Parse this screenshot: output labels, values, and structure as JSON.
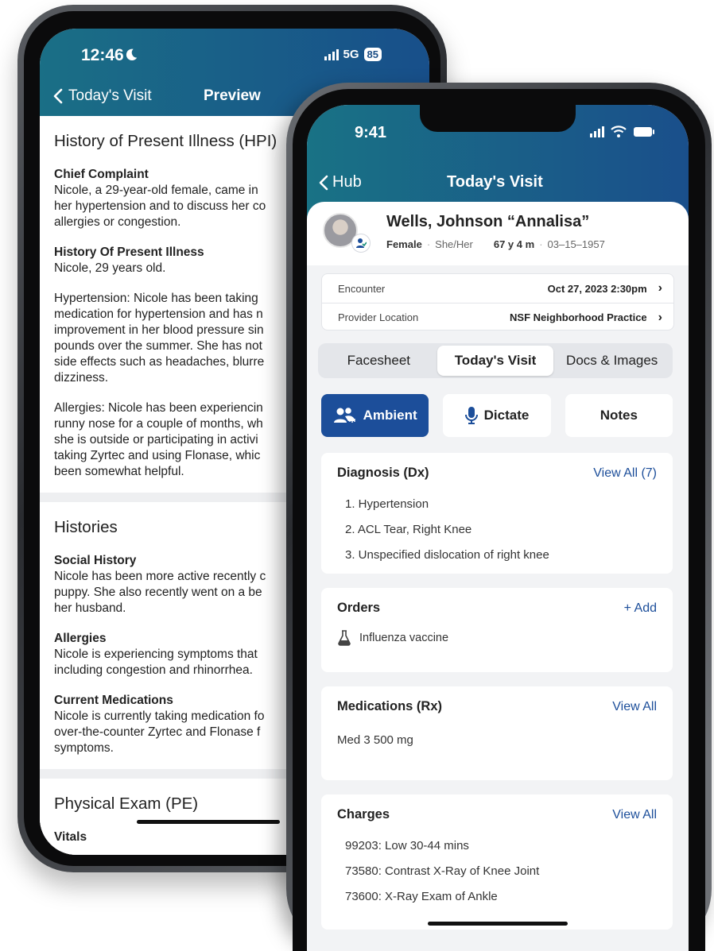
{
  "back_phone": {
    "status": {
      "time": "12:46",
      "network": "5G",
      "battery": "85"
    },
    "nav": {
      "back_label": "Today's Visit",
      "title": "Preview"
    },
    "sections": [
      {
        "title": "History of Present Illness (HPI)",
        "items": [
          {
            "heading": "Chief Complaint",
            "body": "Nicole, a 29-year-old female, came in\nher hypertension and to discuss her co\nallergies or congestion."
          },
          {
            "heading": "History Of Present Illness",
            "body": "Nicole, 29 years old."
          },
          {
            "heading": "",
            "body": "Hypertension: Nicole has been taking\nmedication for hypertension and has n\nimprovement in her blood pressure sin\npounds over the summer. She has not\nside effects such as headaches, blurre\ndizziness."
          },
          {
            "heading": "",
            "body": "Allergies: Nicole has been experiencin\nrunny nose for a couple of months, wh\nshe is outside or participating in activi\ntaking Zyrtec and using Flonase, whic\nbeen somewhat helpful."
          }
        ]
      },
      {
        "title": "Histories",
        "items": [
          {
            "heading": "Social History",
            "body": "Nicole has been more active recently c\npuppy. She also recently went on a be\nher husband."
          },
          {
            "heading": "Allergies",
            "body": "Nicole is experiencing symptoms that\nincluding congestion and rhinorrhea."
          },
          {
            "heading": "Current Medications",
            "body": "Nicole is currently taking medication fo\nover-the-counter Zyrtec and Flonase f\nsymptoms."
          }
        ]
      },
      {
        "title": "Physical Exam (PE)",
        "items": [
          {
            "heading": "Vitals",
            "body": ""
          }
        ]
      }
    ]
  },
  "front_phone": {
    "status": {
      "time": "9:41"
    },
    "nav": {
      "back_label": "Hub",
      "title": "Today's Visit"
    },
    "patient": {
      "name": "Wells, Johnson “Annalisa”",
      "sex": "Female",
      "pronouns": "She/Her",
      "age": "67 y 4 m",
      "dob": "03–15–1957"
    },
    "info_rows": [
      {
        "label": "Encounter",
        "value": "Oct 27, 2023 2:30pm"
      },
      {
        "label": "Provider Location",
        "value": "NSF Neighborhood Practice"
      }
    ],
    "tabs": [
      {
        "label": "Facesheet",
        "active": false
      },
      {
        "label": "Today's Visit",
        "active": true
      },
      {
        "label": "Docs & Images",
        "active": false
      }
    ],
    "modes": {
      "ambient": "Ambient",
      "dictate": "Dictate",
      "notes": "Notes"
    },
    "diagnosis": {
      "title": "Diagnosis (Dx)",
      "link": "View All (7)",
      "items": [
        "1. Hypertension",
        "2. ACL Tear, Right Knee",
        "3. Unspecified dislocation of right knee"
      ]
    },
    "orders": {
      "title": "Orders",
      "link": "+  Add",
      "items": [
        "Influenza vaccine"
      ]
    },
    "medications": {
      "title": "Medications (Rx)",
      "link": "View All",
      "items": [
        "Med 3 500 mg"
      ]
    },
    "charges": {
      "title": "Charges",
      "link": "View All",
      "items": [
        "99203: Low 30-44 mins",
        "73580: Contrast X-Ray of Knee Joint",
        "73600: X-Ray Exam of Ankle"
      ]
    }
  },
  "colors": {
    "header_start": "#197285",
    "header_end": "#1a4f8b",
    "primary": "#1c4e9a"
  },
  "icons": [
    "moon-icon",
    "signal-icon",
    "wifi-icon",
    "battery-icon",
    "chevron-left-icon",
    "chevron-right-icon",
    "ambient-people-icon",
    "microphone-icon",
    "flask-icon",
    "avatar-badge-icon"
  ]
}
